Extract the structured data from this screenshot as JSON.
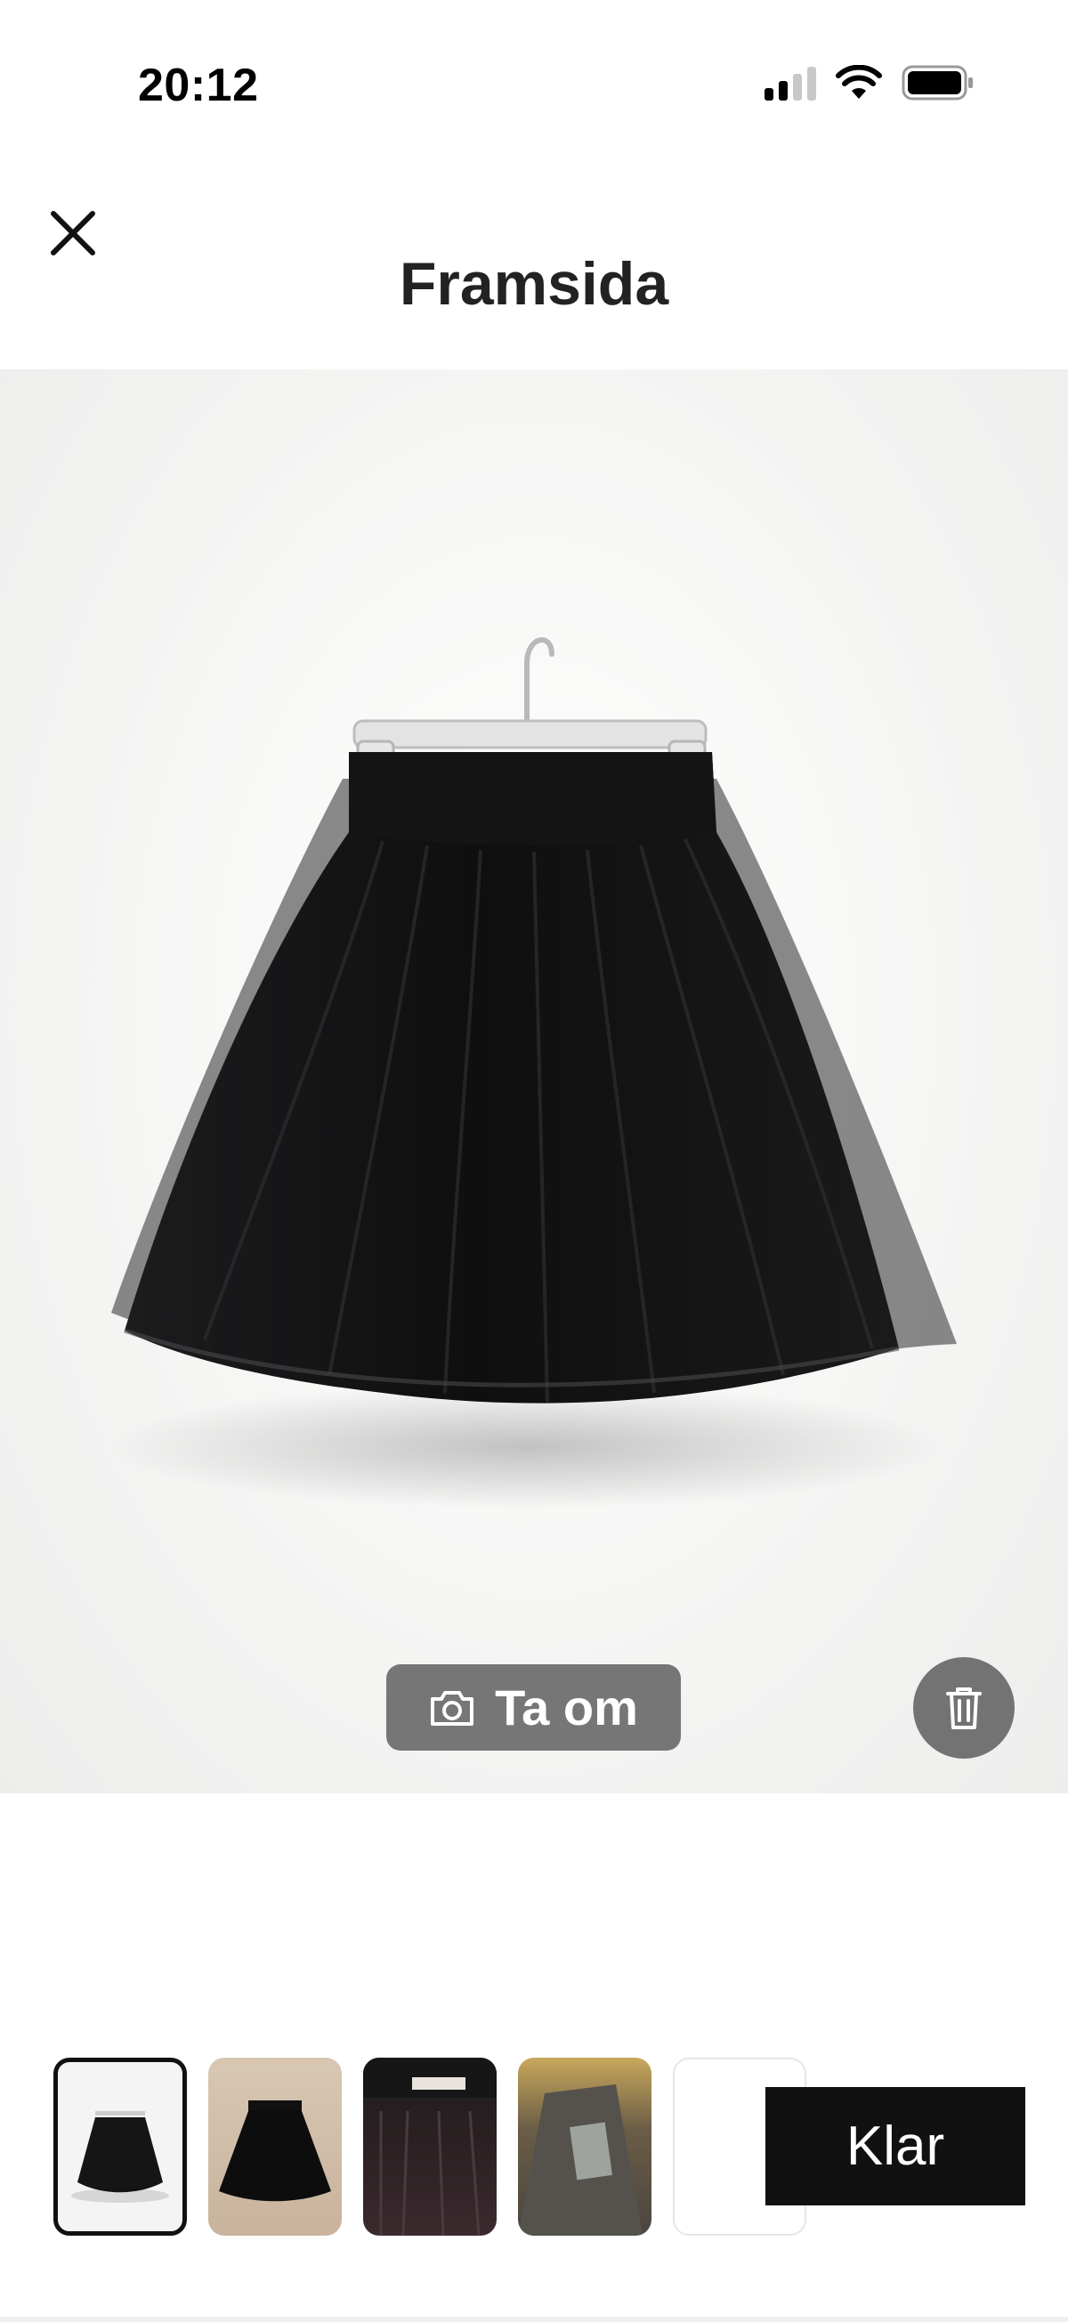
{
  "status_bar": {
    "time": "20:12",
    "icons": [
      "cellular-signal-icon",
      "wifi-icon",
      "battery-icon"
    ]
  },
  "header": {
    "title": "Framsida",
    "close_icon": "close-icon"
  },
  "photo": {
    "retake_label": "Ta om",
    "retake_icon": "camera-icon",
    "delete_icon": "trash-icon"
  },
  "thumbnails": [
    {
      "name": "front",
      "selected": true
    },
    {
      "name": "laid-flat",
      "selected": false
    },
    {
      "name": "waistband-label",
      "selected": false
    },
    {
      "name": "care-label",
      "selected": false
    },
    {
      "name": "empty-slot",
      "selected": false
    }
  ],
  "done_label": "Klar",
  "colors": {
    "primary": "#111111",
    "overlay_button": "#767676",
    "photo_background": "#f2f2f1"
  }
}
